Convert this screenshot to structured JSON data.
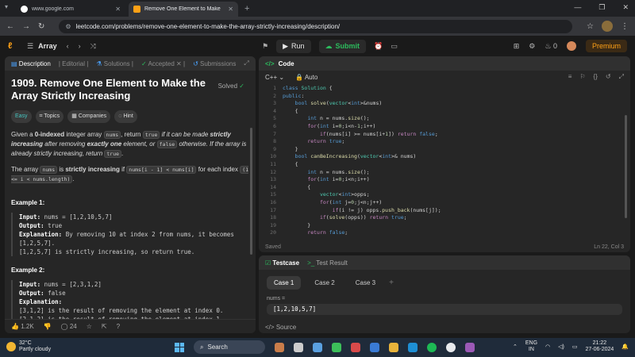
{
  "browser": {
    "tabs": [
      {
        "title": "www.google.com",
        "active": false
      },
      {
        "title": "Remove One Element to Make",
        "active": true
      }
    ],
    "url": "leetcode.com/problems/remove-one-element-to-make-the-array-strictly-increasing/description/"
  },
  "lc_top": {
    "list_label": "Array",
    "run": "Run",
    "submit": "Submit",
    "streak": "0",
    "premium": "Premium"
  },
  "left_tabs": {
    "description": "Description",
    "editorial": "Editorial",
    "solutions": "Solutions",
    "accepted": "Accepted",
    "submissions": "Submissions"
  },
  "problem": {
    "title": "1909. Remove One Element to Make the Array Strictly Increasing",
    "status": "Solved",
    "difficulty": "Easy",
    "chips": [
      "Topics",
      "Companies",
      "Hint"
    ],
    "p1_a": "Given a ",
    "p1_b": "0-indexed",
    "p1_c": " integer array ",
    "p1_d": "nums",
    "p1_e": ", return ",
    "p1_f": "true",
    "p1_g": " if it can be made ",
    "p1_h": "strictly increasing",
    "p1_i": " after removing ",
    "p1_j": "exactly one",
    "p1_k": " element, or ",
    "p1_l": "false",
    "p1_m": " otherwise. If the array is already strictly increasing, return ",
    "p1_n": "true",
    "p1_o": ".",
    "p2_a": "The array ",
    "p2_b": "nums",
    "p2_c": " is ",
    "p2_d": "strictly increasing",
    "p2_e": " if ",
    "p2_f": "nums[i - 1] < nums[i]",
    "p2_g": " for each index ",
    "p2_h": "(1 <= i < nums.length)",
    "p2_i": ".",
    "ex1_title": "Example 1:",
    "ex1_input_label": "Input:",
    "ex1_input": " nums = [1,2,10,5,7]",
    "ex1_output_label": "Output:",
    "ex1_output": " true",
    "ex1_expl_label": "Explanation:",
    "ex1_expl1": " By removing 10 at index 2 from nums, it becomes",
    "ex1_expl2": "[1,2,5,7].",
    "ex1_expl3": "[1,2,5,7] is strictly increasing, so return true.",
    "ex2_title": "Example 2:",
    "ex2_input_label": "Input:",
    "ex2_input": " nums = [2,3,1,2]",
    "ex2_output_label": "Output:",
    "ex2_output": " false",
    "ex2_expl_label": "Explanation:",
    "ex2_expl1": "[3,1,2] is the result of removing the element at index 0.",
    "ex2_expl2": "[2,1,2] is the result of removing the element at index 1."
  },
  "footer": {
    "likes": "1.2K",
    "comments": "24"
  },
  "code": {
    "header": "Code",
    "language": "C++",
    "mode": "Auto",
    "status_left": "Saved",
    "status_right": "Ln 22, Col 3",
    "line_numbers": [
      "1",
      "2",
      "3",
      "4",
      "5",
      "6",
      "7",
      "8",
      "9",
      "10",
      "11",
      "12",
      "13",
      "14",
      "15",
      "16",
      "17",
      "18",
      "19",
      "20"
    ]
  },
  "testcase": {
    "tab1": "Testcase",
    "tab2": "Test Result",
    "cases": [
      "Case 1",
      "Case 2",
      "Case 3"
    ],
    "var_label": "nums =",
    "var_value": "[1,2,10,5,7]",
    "source": "Source"
  },
  "taskbar": {
    "temp": "32°C",
    "weather": "Partly cloudy",
    "search": "Search",
    "lang1": "ENG",
    "lang2": "IN",
    "time": "21:22",
    "date": "27-06-2024"
  },
  "colors": {
    "accent": "#ffa116",
    "green": "#2cbb5d",
    "easy": "#46c6c2"
  }
}
